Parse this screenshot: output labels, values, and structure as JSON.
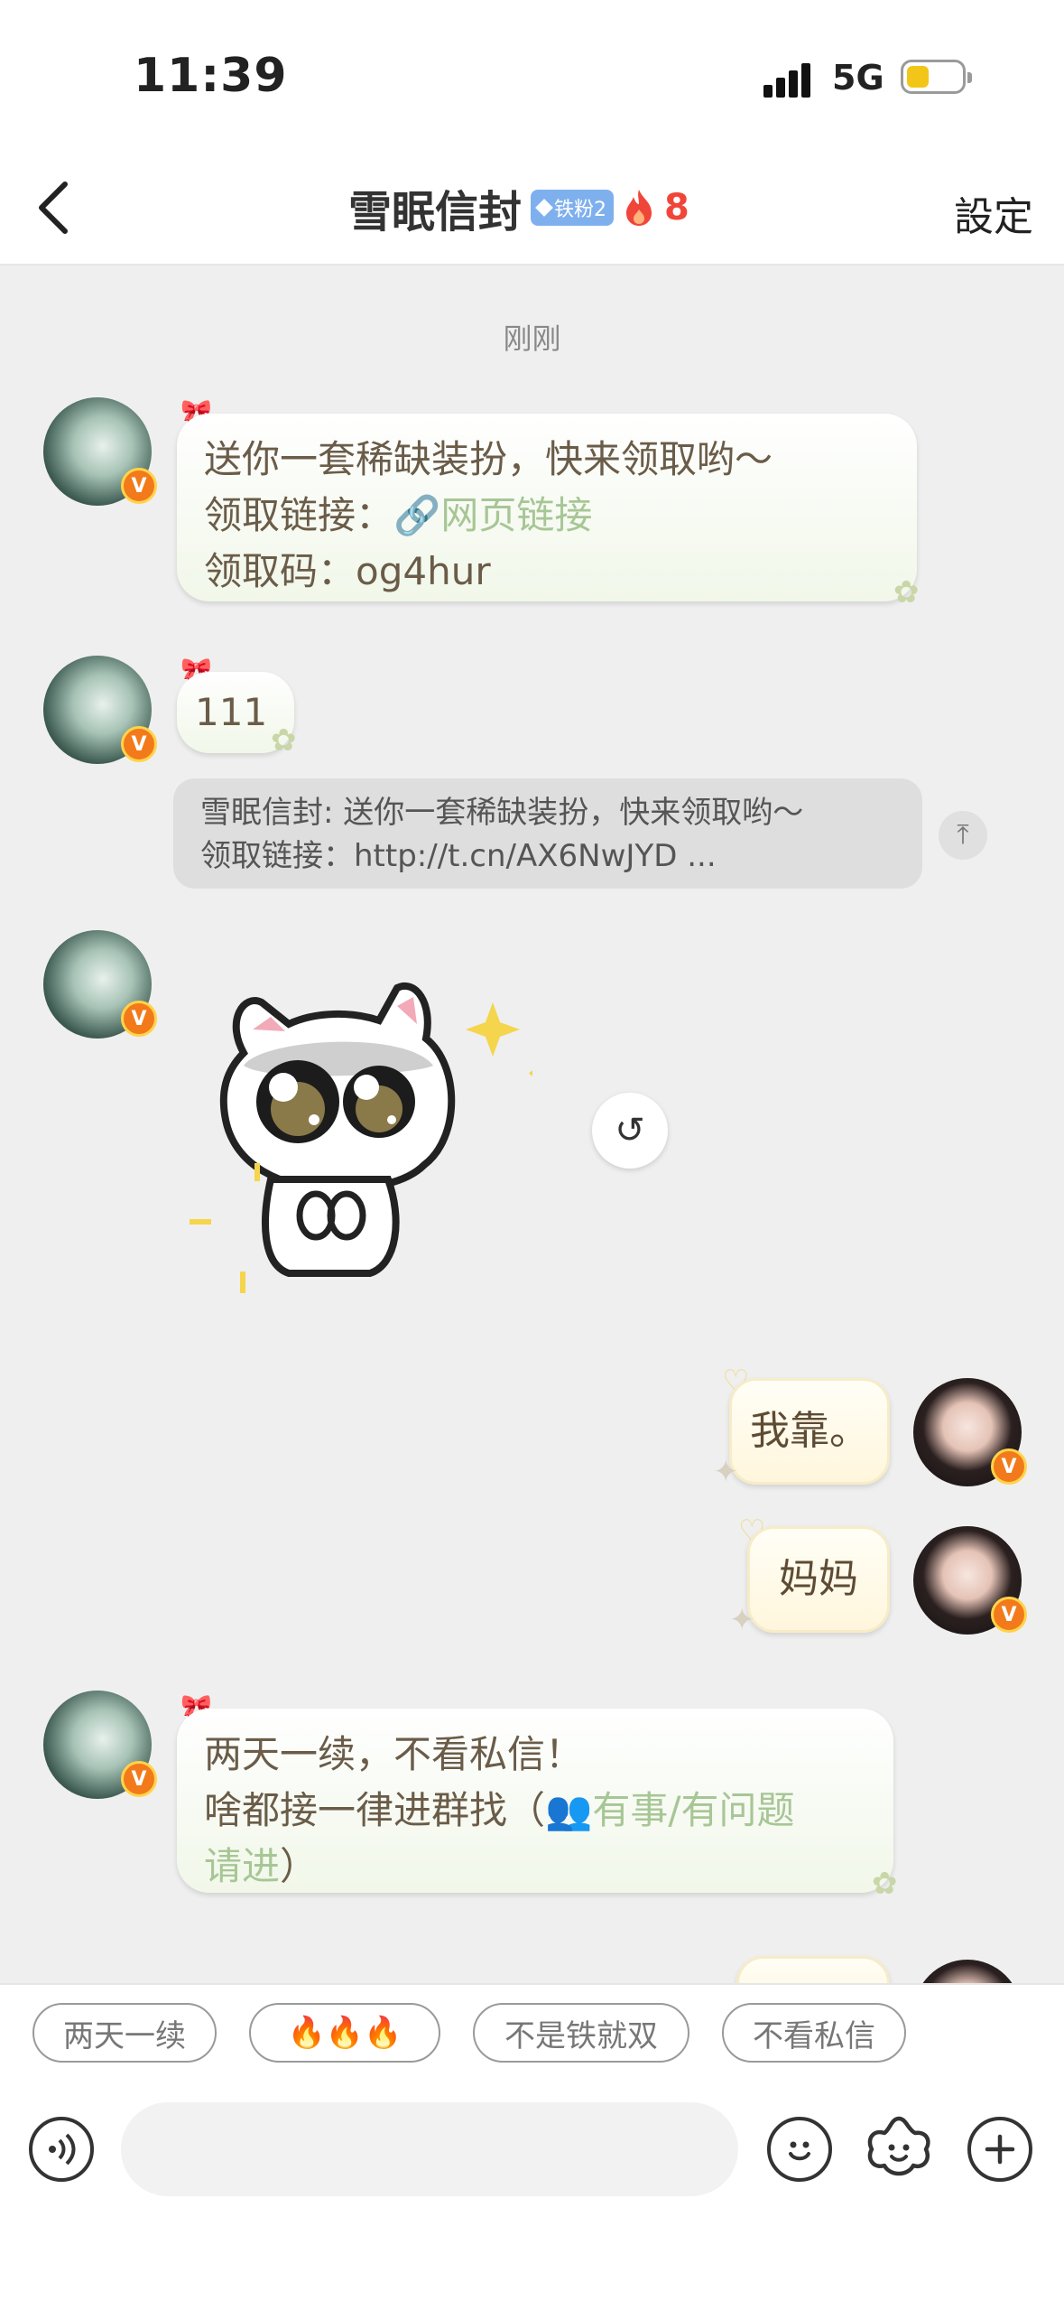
{
  "status_bar": {
    "time": "11:39",
    "network": "5G"
  },
  "nav": {
    "title": "雪眠信封",
    "fan_badge": "铁粉2",
    "fire_count": "8",
    "settings_label": "設定"
  },
  "chat": {
    "timestamp": "刚刚",
    "msg1": {
      "line1": "送你一套稀缺装扮，快来领取哟～",
      "line2_label": "领取链接：",
      "line2_link": "网页链接",
      "line3": "领取码：og4hur"
    },
    "msg2": {
      "text": "111"
    },
    "quote": {
      "line1": "雪眠信封: 送你一套稀缺装扮，快来领取哟～",
      "line2": "领取链接：http://t.cn/AX6NwJYD ..."
    },
    "msg4": {
      "text": "我靠。"
    },
    "msg5": {
      "text": "妈妈"
    },
    "msg6": {
      "line1": "两天一续，不看私信！",
      "line2_prefix": "啥都接一律进群找（",
      "line2_link": "有事/有问题",
      "line3_link": "请进",
      "line3_suffix": "）"
    }
  },
  "quick_replies": [
    "两天一续",
    "🔥🔥🔥",
    "不是铁就双",
    "不看私信"
  ],
  "input": {
    "placeholder": ""
  },
  "icons": {
    "back": "chevron-left-icon",
    "voice": "voice-icon",
    "emoji": "emoji-icon",
    "sticker": "sticker-icon",
    "plus": "plus-icon",
    "link": "link-icon",
    "group": "group-icon",
    "recall": "undo-icon",
    "scroll_top": "scroll-top-icon",
    "fire": "fire-icon",
    "diamond": "diamond-icon",
    "verified": "verified-badge-icon"
  },
  "colors": {
    "fire": "#f0463a",
    "link": "#a7c695",
    "fan_badge": "#7fb0ee",
    "verified": "#f27a1a"
  }
}
